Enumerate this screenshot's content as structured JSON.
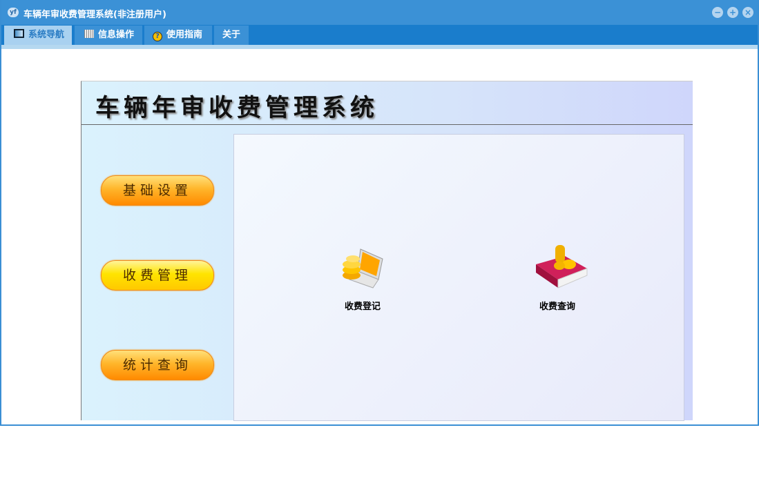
{
  "window": {
    "title": "车辆年审收费管理系统(非注册用户)",
    "app_icon": "yf-icon",
    "controls": [
      "minimize",
      "restore",
      "close"
    ]
  },
  "menu": [
    {
      "label": "系统导航",
      "icon": "monitor-icon",
      "active": true
    },
    {
      "label": "信息操作",
      "icon": "grid-icon",
      "active": false
    },
    {
      "label": "使用指南",
      "icon": "help-icon",
      "active": false
    },
    {
      "label": "关于",
      "active": false
    }
  ],
  "panel": {
    "title": "车辆年审收费管理系统",
    "nav": [
      {
        "label": "基础设置"
      },
      {
        "label": "收费管理"
      },
      {
        "label": "统计查询"
      }
    ],
    "functions": [
      {
        "label": "收费登记",
        "icon": "laptop-coins-icon"
      },
      {
        "label": "收费查询",
        "icon": "book-coins-icon"
      }
    ]
  }
}
